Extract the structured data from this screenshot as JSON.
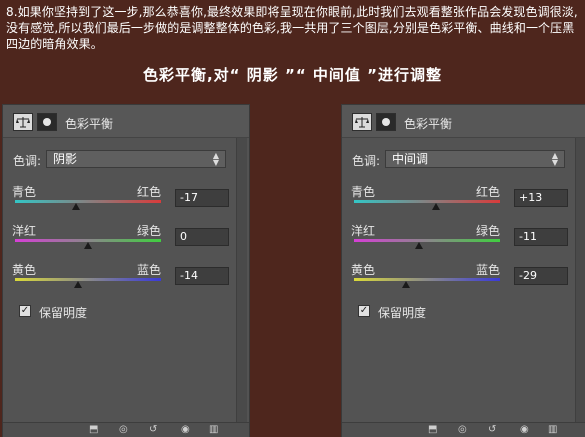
{
  "intro_text": "8.如果你坚持到了这一步,那么恭喜你,最终效果即将呈现在你眼前,此时我们去观看整张作品会发现色调很淡,没有感觉,所以我们最后一步做的是调整整体的色彩,我一共用了三个图层,分别是色彩平衡、曲线和一个压黑四边的暗角效果。",
  "heading": "色彩平衡,对“ 阴影 ”“ 中间值 ”进行调整",
  "panels": [
    {
      "title": "色彩平衡",
      "tone_label": "色调:",
      "tone_value": "阴影",
      "sliders": [
        {
          "left": "青色",
          "right": "红色",
          "value": "-17",
          "level": -17,
          "gradient": [
            "#33c6c6",
            "#d93b3b"
          ]
        },
        {
          "left": "洋红",
          "right": "绿色",
          "value": "0",
          "level": 0,
          "gradient": [
            "#d63fd6",
            "#3fcf3f"
          ]
        },
        {
          "left": "黄色",
          "right": "蓝色",
          "value": "-14",
          "level": -14,
          "gradient": [
            "#d9d93a",
            "#3a3ad9"
          ]
        }
      ],
      "preserve_label": "保留明度",
      "preserve_checked": true
    },
    {
      "title": "色彩平衡",
      "tone_label": "色调:",
      "tone_value": "中间调",
      "sliders": [
        {
          "left": "青色",
          "right": "红色",
          "value": "+13",
          "level": 13,
          "gradient": [
            "#33c6c6",
            "#d93b3b"
          ]
        },
        {
          "left": "洋红",
          "right": "绿色",
          "value": "-11",
          "level": -11,
          "gradient": [
            "#d63fd6",
            "#3fcf3f"
          ]
        },
        {
          "left": "黄色",
          "right": "蓝色",
          "value": "-29",
          "level": -29,
          "gradient": [
            "#d9d93a",
            "#3a3ad9"
          ]
        }
      ],
      "preserve_label": "保留明度",
      "preserve_checked": true
    }
  ],
  "icons": {
    "balance": "balance-scale-icon",
    "mask": "layer-mask-icon",
    "footer": [
      "clip-to-layer-icon",
      "view-previous-state-icon",
      "reset-icon",
      "visibility-eye-icon",
      "delete-trash-icon"
    ]
  }
}
